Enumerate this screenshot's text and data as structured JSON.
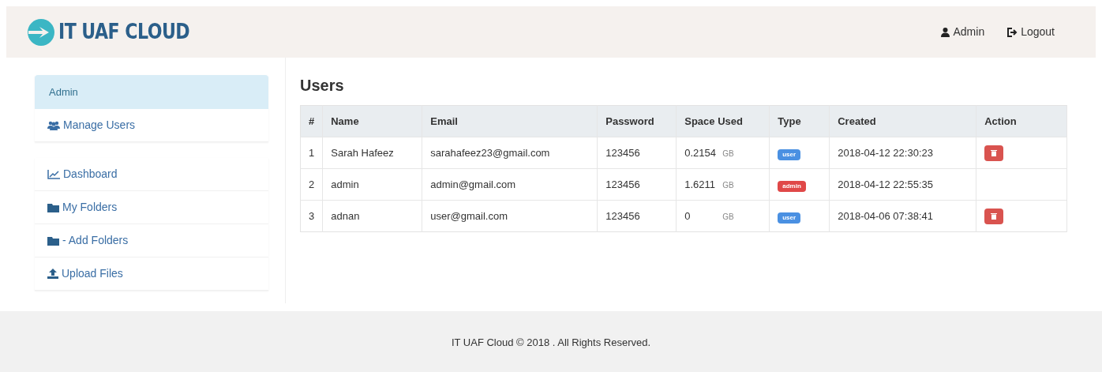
{
  "header": {
    "brand": "IT UAF CLOUD",
    "user": "Admin",
    "logout": "Logout"
  },
  "sidebar": {
    "groups": [
      {
        "items": [
          {
            "kind": "heading",
            "label": "Admin"
          },
          {
            "kind": "link",
            "label": "Manage Users"
          }
        ]
      },
      {
        "items": [
          {
            "kind": "link",
            "label": "Dashboard"
          },
          {
            "kind": "link",
            "label": "My Folders"
          },
          {
            "kind": "link",
            "label": "- Add Folders"
          },
          {
            "kind": "link",
            "label": "Upload Files"
          }
        ]
      }
    ]
  },
  "page_title": "Users",
  "table": {
    "columns": [
      "#",
      "Name",
      "Email",
      "Password",
      "Space Used",
      "Type",
      "Created",
      "Action"
    ],
    "rows": [
      {
        "index": "1",
        "name": "Sarah Hafeez",
        "email": "sarahafeez23@gmail.com",
        "password": "123456",
        "space": "0.2154",
        "unit": "GB",
        "type": "user",
        "color": "#4a90e2",
        "created": "2018-04-12 22:30:23",
        "deletable": true
      },
      {
        "index": "2",
        "name": "admin",
        "email": "admin@gmail.com",
        "password": "123456",
        "space": "1.6211",
        "unit": "GB",
        "type": "admin",
        "color": "#e04848",
        "created": "2018-04-12 22:55:35",
        "deletable": false
      },
      {
        "index": "3",
        "name": "adnan",
        "email": "user@gmail.com",
        "password": "123456",
        "space": "0",
        "unit": "GB",
        "type": "user",
        "color": "#4a90e2",
        "created": "2018-04-06 07:38:41",
        "deletable": true
      }
    ]
  },
  "footer": "IT UAF Cloud © 2018 . All Rights Reserved."
}
